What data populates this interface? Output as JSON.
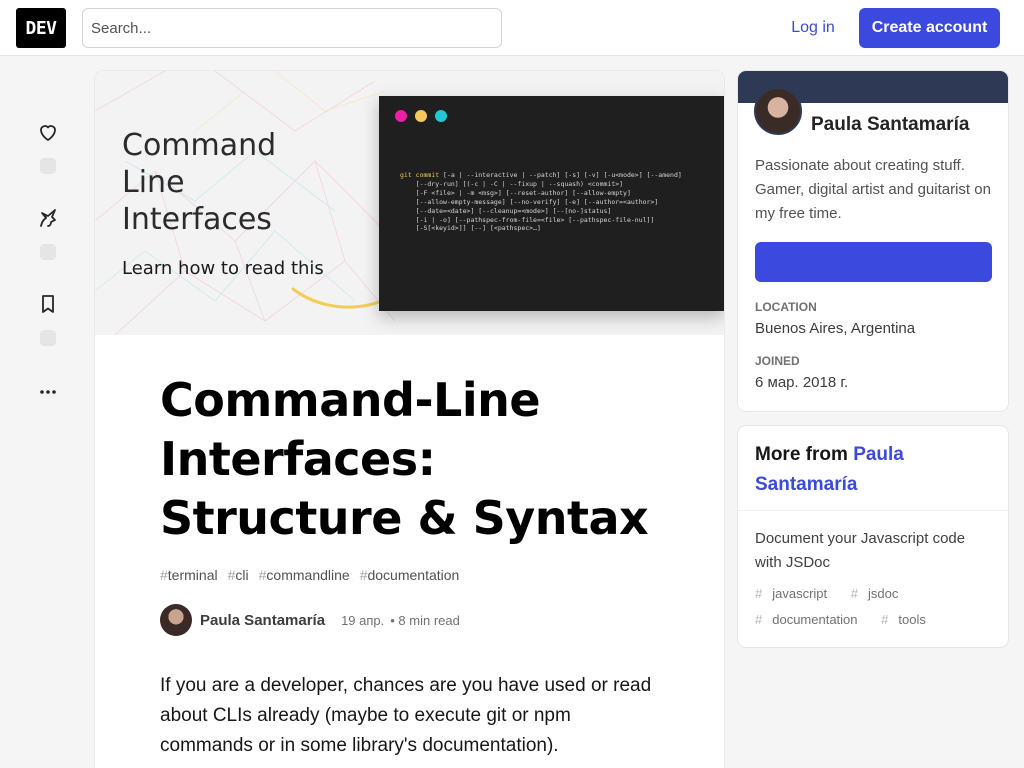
{
  "header": {
    "logo": "DEV",
    "search_placeholder": "Search...",
    "login_label": "Log in",
    "create_account_label": "Create account"
  },
  "reactions": [
    {
      "icon": "heart-icon"
    },
    {
      "icon": "unicorn-icon"
    },
    {
      "icon": "bookmark-icon"
    },
    {
      "icon": "more-icon"
    }
  ],
  "cover": {
    "title_line1": "Command",
    "title_line2": "Line",
    "title_line3": "Interfaces",
    "subtitle": "Learn how to read this",
    "code_command": "git commit",
    "code_line1": " [-a | --interactive | --patch] [-s] [-v] [-u<mode>] [--amend]",
    "code_line2": "    [--dry-run] [(-c | -C | --fixup | --squash) <commit>]",
    "code_line3": "    [-F <file> | -m <msg>] [--reset-author] [--allow-empty]",
    "code_line4": "    [--allow-empty-message] [--no-verify] [-e] [--author=<author>]",
    "code_line5": "    [--date=<date>] [--cleanup=<mode>] [--[no-]status]",
    "code_line6": "    [-i | -o] [--pathspec-from-file=<file> [--pathspec-file-nul]]",
    "code_line7": "    [-S[<keyid>]] [--] [<pathspec>…]"
  },
  "article": {
    "title": "Command-Line Interfaces: Structure & Syntax",
    "tags": [
      "terminal",
      "cli",
      "commandline",
      "documentation"
    ],
    "author": "Paula Santamaría",
    "date": "19 апр.",
    "read_time": "• 8 min read",
    "body": "If you are a developer, chances are you have used or read about CLIs already (maybe to execute git or npm commands or in some library's documentation)."
  },
  "profile": {
    "name": "Paula Santamaría",
    "bio": "Passionate about creating stuff. Gamer, digital artist and guitarist on my free time.",
    "location_label": "LOCATION",
    "location": "Buenos Aires, Argentina",
    "joined_label": "JOINED",
    "joined": "6 мар. 2018 г."
  },
  "more_from": {
    "prefix": "More from",
    "author": "Paula Santamaría",
    "items": [
      {
        "title": "Document your Javascript code with JSDoc",
        "tags": [
          "javascript",
          "jsdoc",
          "documentation",
          "tools"
        ]
      }
    ]
  },
  "colors": {
    "accent": "#3b49df",
    "profile_banner": "#2e3a55",
    "terminal_bg": "#1f1f1f",
    "dot_magenta": "#e91fa6",
    "dot_yellow": "#f4c95a",
    "dot_cyan": "#22c7d4"
  }
}
